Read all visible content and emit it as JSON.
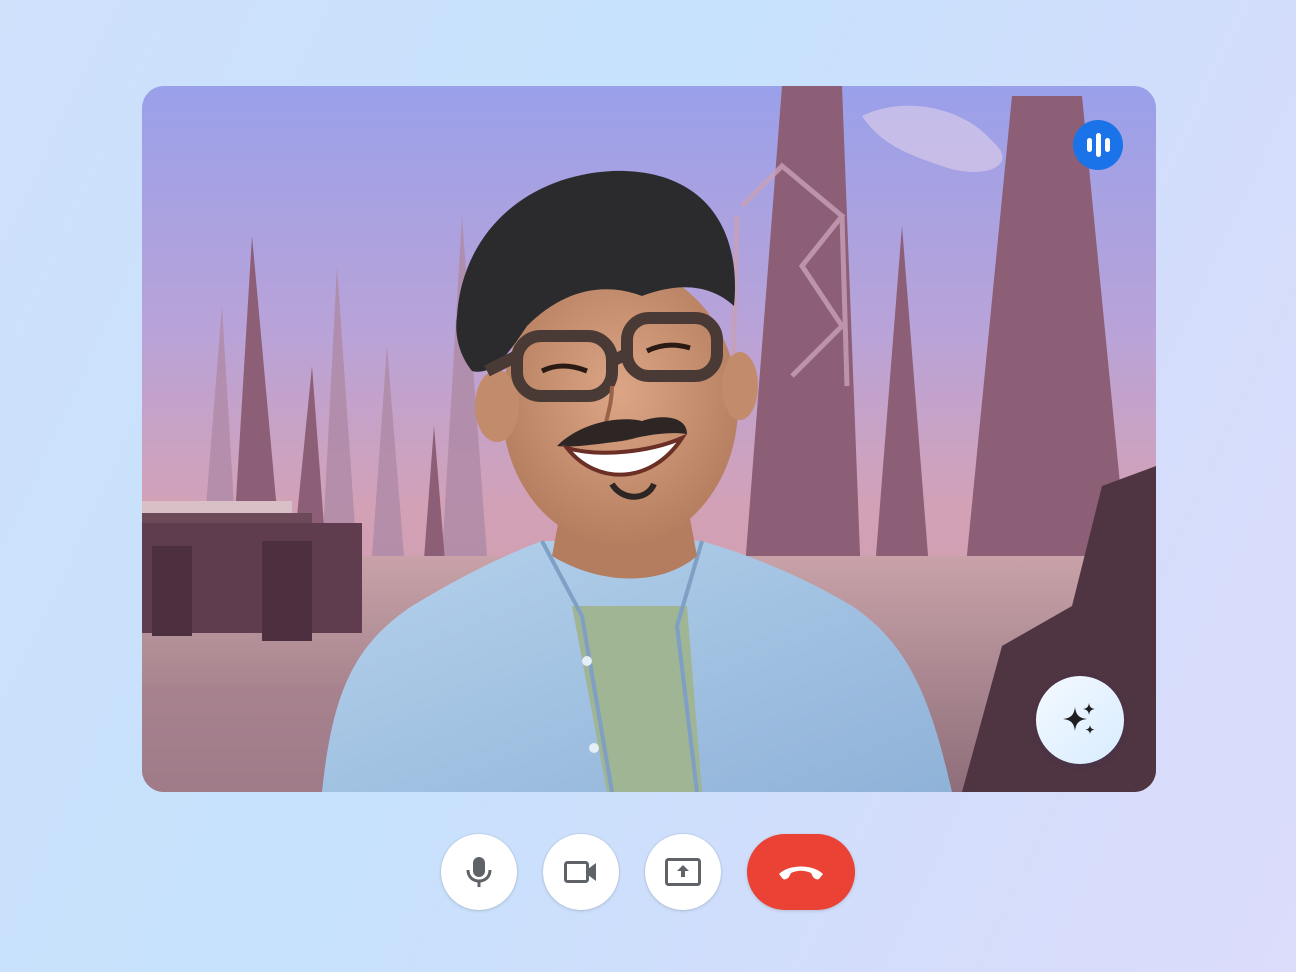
{
  "call": {
    "video_tile": {
      "participant_view": "self-view-camera",
      "background_effect": "futuristic-city-painting",
      "speaking": true
    },
    "indicators": {
      "speaking_icon": "audio-level-icon",
      "effects_icon": "sparkle-icon"
    },
    "controls": [
      {
        "id": "microphone",
        "icon": "microphone-icon"
      },
      {
        "id": "camera",
        "icon": "video-camera-icon"
      },
      {
        "id": "present",
        "icon": "present-screen-icon"
      },
      {
        "id": "leave",
        "icon": "phone-hangup-icon"
      }
    ]
  },
  "colors": {
    "accent_blue": "#1a73e8",
    "hangup_red": "#ea4335",
    "icon_gray": "#5f6368",
    "background": "#cfe0fb"
  }
}
